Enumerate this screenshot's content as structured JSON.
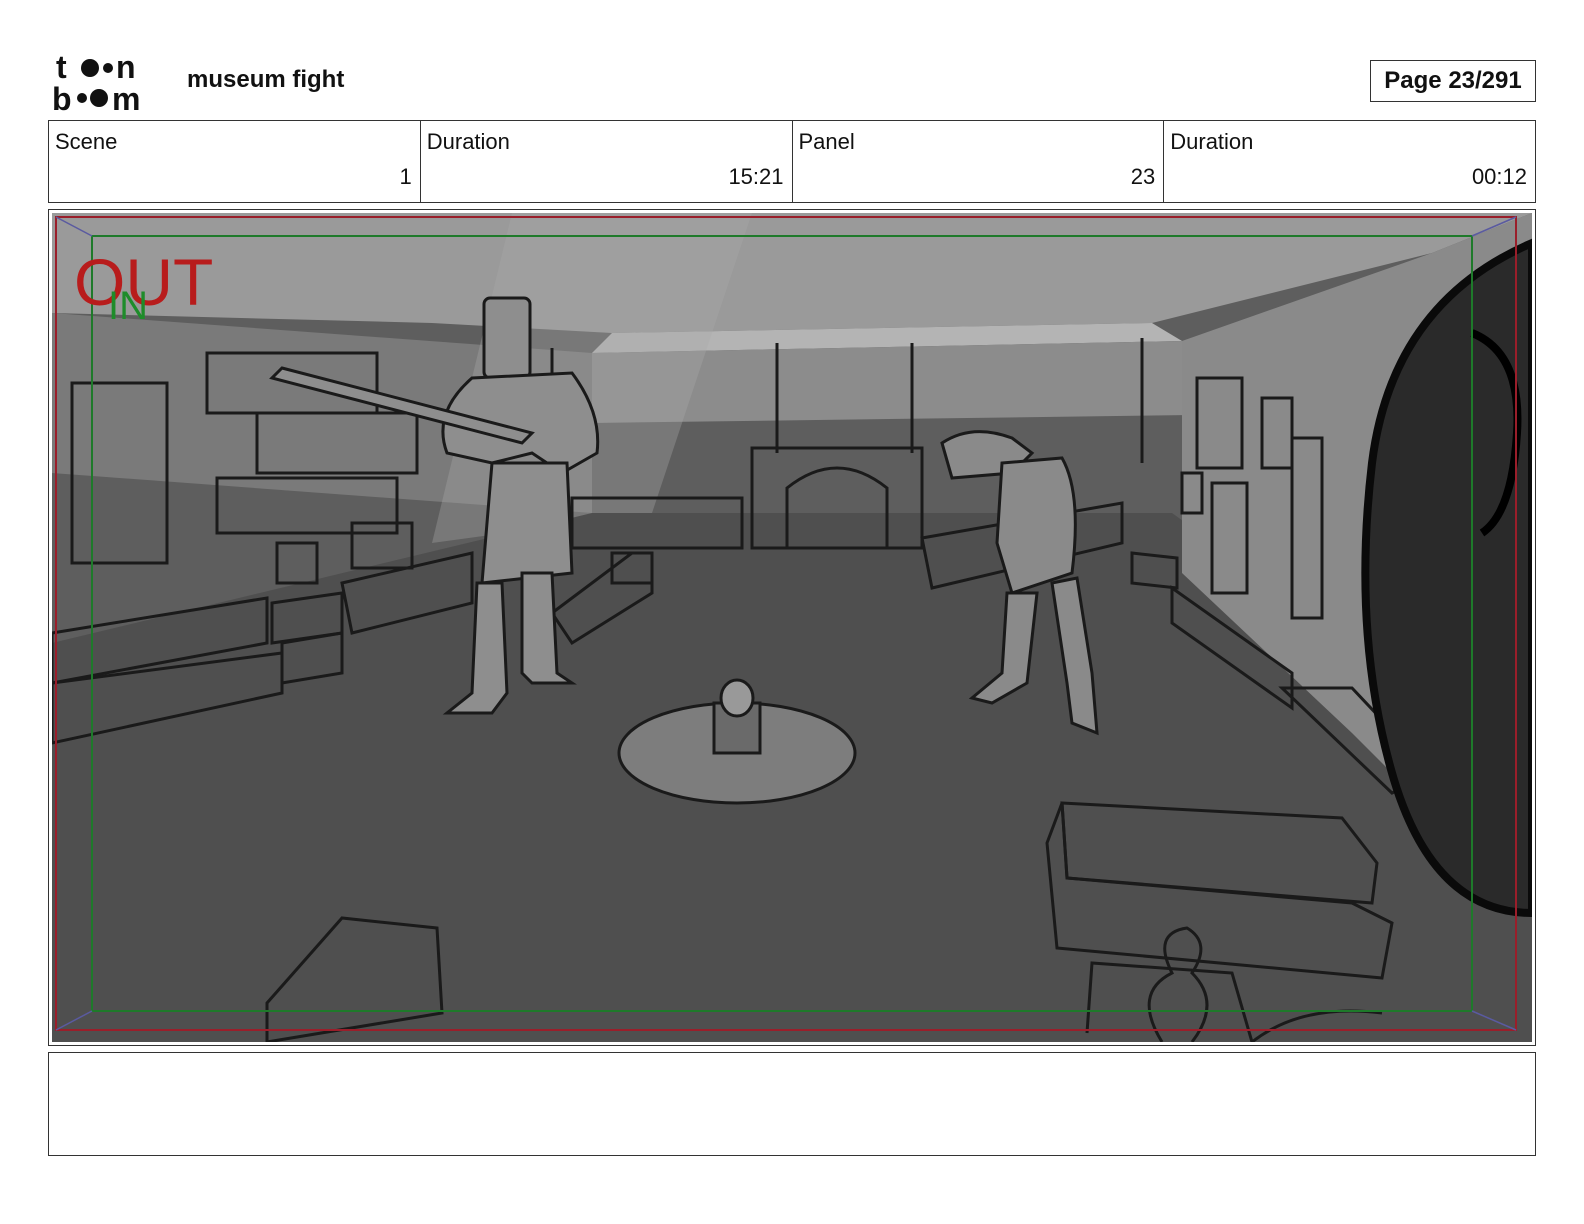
{
  "header": {
    "logo_text": "toon boom",
    "project_title": "museum fight",
    "page_label": "Page",
    "page_value": "23/291"
  },
  "info": [
    {
      "label": "Scene",
      "value": "1"
    },
    {
      "label": "Duration",
      "value": "15:21"
    },
    {
      "label": "Panel",
      "value": "23"
    },
    {
      "label": "Duration",
      "value": "00:12"
    }
  ],
  "panel": {
    "out_label": "OUT",
    "in_label": "IN",
    "colors": {
      "out": "#b81c1c",
      "in": "#1e8c2a",
      "safe_frame": "#1e7a2a",
      "camera_frame": "#9a1e2a"
    }
  },
  "notes": {
    "text": ""
  }
}
